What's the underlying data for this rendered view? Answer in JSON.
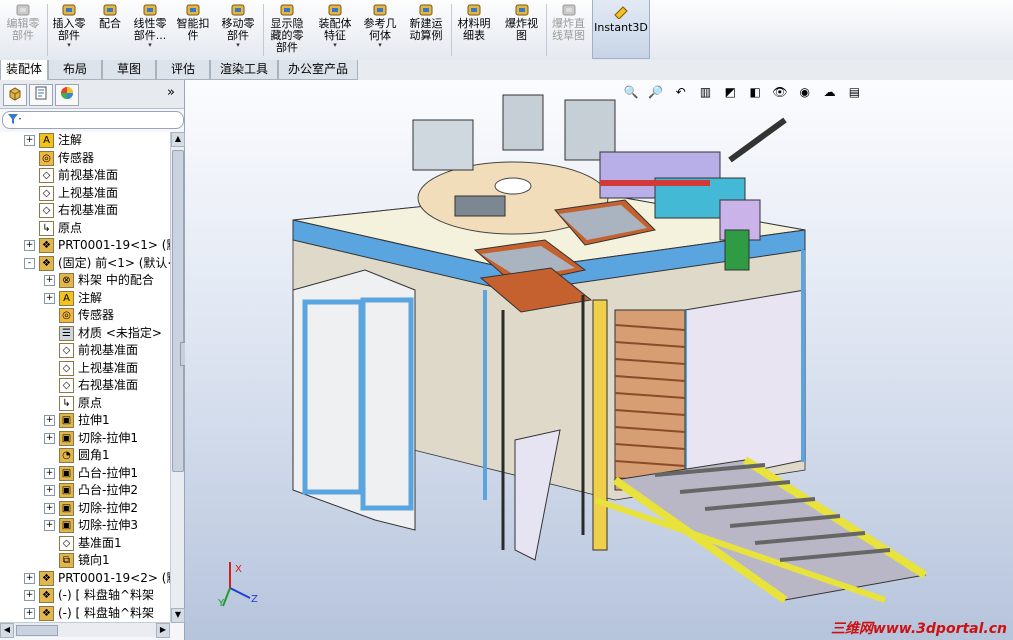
{
  "ribbon": {
    "buttons": [
      {
        "label": "编辑零\n部件",
        "icon": "edit-component-icon",
        "disabled": true,
        "dropdown": false
      },
      {
        "label": "插入零\n部件",
        "icon": "insert-component-icon",
        "disabled": false,
        "dropdown": true
      },
      {
        "label": "配合",
        "icon": "mate-icon",
        "disabled": false,
        "dropdown": false
      },
      {
        "label": "线性零\n部件...",
        "icon": "linear-pattern-icon",
        "disabled": false,
        "dropdown": true
      },
      {
        "label": "智能扣\n件",
        "icon": "smart-fastener-icon",
        "disabled": false,
        "dropdown": false
      },
      {
        "label": "移动零\n部件",
        "icon": "move-component-icon",
        "disabled": false,
        "dropdown": true
      },
      {
        "label": "显示隐\n藏的零\n部件",
        "icon": "show-hidden-icon",
        "disabled": false,
        "dropdown": false
      },
      {
        "label": "装配体\n特征",
        "icon": "assembly-feature-icon",
        "disabled": false,
        "dropdown": true
      },
      {
        "label": "参考几\n何体",
        "icon": "reference-geometry-icon",
        "disabled": false,
        "dropdown": true
      },
      {
        "label": "新建运\n动算例",
        "icon": "motion-study-icon",
        "disabled": false,
        "dropdown": false
      },
      {
        "label": "材料明\n细表",
        "icon": "bom-icon",
        "disabled": false,
        "dropdown": false
      },
      {
        "label": "爆炸视\n图",
        "icon": "explode-view-icon",
        "disabled": false,
        "dropdown": false
      },
      {
        "label": "爆炸直\n线草图",
        "icon": "explode-line-icon",
        "disabled": true,
        "dropdown": false
      },
      {
        "label": "Instant3D",
        "icon": "instant3d-icon",
        "disabled": false,
        "dropdown": false
      }
    ]
  },
  "tabs": [
    "装配体",
    "布局",
    "草图",
    "评估",
    "渲染工具",
    "办公室产品"
  ],
  "panel": {
    "expand_label": "»",
    "tree": [
      {
        "label": "注解",
        "icon": "annotation-icon",
        "expand": "+",
        "level": 1
      },
      {
        "label": "传感器",
        "icon": "sensor-icon",
        "expand": "",
        "level": 1
      },
      {
        "label": "前视基准面",
        "icon": "plane-icon",
        "expand": "",
        "level": 1
      },
      {
        "label": "上视基准面",
        "icon": "plane-icon",
        "expand": "",
        "level": 1
      },
      {
        "label": "右视基准面",
        "icon": "plane-icon",
        "expand": "",
        "level": 1
      },
      {
        "label": "原点",
        "icon": "origin-icon",
        "expand": "",
        "level": 1
      },
      {
        "label": "PRT0001-19<1> (默认",
        "icon": "part-icon",
        "expand": "+",
        "level": 1
      },
      {
        "label": "(固定) 前<1> (默认<",
        "icon": "subassembly-icon",
        "expand": "-",
        "level": 1
      },
      {
        "label": "料架 中的配合",
        "icon": "mates-folder-icon",
        "expand": "+",
        "level": 2
      },
      {
        "label": "注解",
        "icon": "annotation-icon",
        "expand": "+",
        "level": 2
      },
      {
        "label": "传感器",
        "icon": "sensor-icon",
        "expand": "",
        "level": 2
      },
      {
        "label": "材质 <未指定>",
        "icon": "material-icon",
        "expand": "",
        "level": 2
      },
      {
        "label": "前视基准面",
        "icon": "plane-icon",
        "expand": "",
        "level": 2
      },
      {
        "label": "上视基准面",
        "icon": "plane-icon",
        "expand": "",
        "level": 2
      },
      {
        "label": "右视基准面",
        "icon": "plane-icon",
        "expand": "",
        "level": 2
      },
      {
        "label": "原点",
        "icon": "origin-icon",
        "expand": "",
        "level": 2
      },
      {
        "label": "拉伸1",
        "icon": "extrude-icon",
        "expand": "+",
        "level": 2
      },
      {
        "label": "切除-拉伸1",
        "icon": "cut-extrude-icon",
        "expand": "+",
        "level": 2
      },
      {
        "label": "圆角1",
        "icon": "fillet-icon",
        "expand": "",
        "level": 2
      },
      {
        "label": "凸台-拉伸1",
        "icon": "boss-extrude-icon",
        "expand": "+",
        "level": 2
      },
      {
        "label": "凸台-拉伸2",
        "icon": "boss-extrude-icon",
        "expand": "+",
        "level": 2
      },
      {
        "label": "切除-拉伸2",
        "icon": "cut-extrude-icon",
        "expand": "+",
        "level": 2
      },
      {
        "label": "切除-拉伸3",
        "icon": "cut-extrude-icon",
        "expand": "+",
        "level": 2
      },
      {
        "label": "基准面1",
        "icon": "plane-icon",
        "expand": "",
        "level": 2
      },
      {
        "label": "镜向1",
        "icon": "mirror-icon",
        "expand": "",
        "level": 2
      },
      {
        "label": "PRT0001-19<2> (默认",
        "icon": "part-icon",
        "expand": "+",
        "level": 1
      },
      {
        "label": "(-) [ 料盘轴^料架",
        "icon": "subassembly-icon",
        "expand": "+",
        "level": 1
      },
      {
        "label": "(-) [ 料盘轴^料架",
        "icon": "subassembly-icon",
        "expand": "+",
        "level": 1
      }
    ]
  },
  "viewport": {
    "triad_labels": {
      "x": "X",
      "y": "Y",
      "z": "Z"
    },
    "watermark": "三维网www.3dportal.cn"
  },
  "colors": {
    "tabletop": "#f4f2dc",
    "frame_blue": "#5aa4df",
    "tray_orange": "#c5612f",
    "conveyor_yellow": "#e8e23c",
    "watermark_red": "#cc1111"
  }
}
